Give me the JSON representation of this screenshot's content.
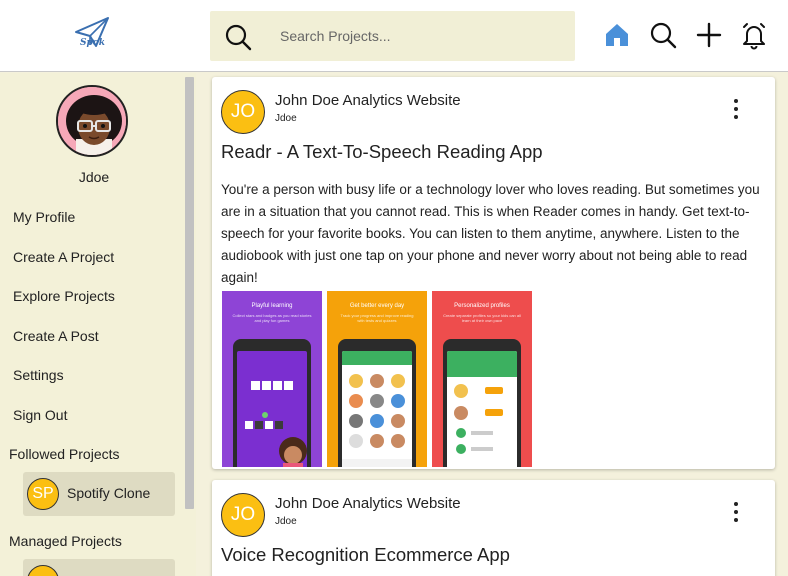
{
  "app": {
    "logo_text": "Spok"
  },
  "search": {
    "placeholder": "Search Projects..."
  },
  "header_icons": [
    "home-icon",
    "search-icon",
    "plus-icon",
    "bell-icon"
  ],
  "colors": {
    "accent": "#4a90d9",
    "badge": "#fbbf12",
    "background": "#f4f1dc",
    "chip": "#dedbc2"
  },
  "sidebar": {
    "username": "Jdoe",
    "nav": [
      {
        "label": "My Profile"
      },
      {
        "label": "Create A Project"
      },
      {
        "label": "Explore Projects"
      },
      {
        "label": "Create A Post"
      },
      {
        "label": "Settings"
      },
      {
        "label": "Sign Out"
      }
    ],
    "followed_label": "Followed Projects",
    "followed": [
      {
        "initials": "SP",
        "name": "Spotify Clone"
      }
    ],
    "managed_label": "Managed Projects"
  },
  "feed": {
    "posts": [
      {
        "initials": "JO",
        "owner": "John Doe Analytics Website",
        "handle": "Jdoe",
        "title": "Readr - A Text-To-Speech Reading App",
        "description": "You're a person with busy life or a technology lover who loves reading. But sometimes you are in a situation that you cannot read. This is when Reader comes in handy. Get text-to-speech for your favorite books. You can listen to them anytime, anywhere. Listen to the audiobook with just one tap on your phone and never worry about not being able to read again!",
        "screenshots": [
          {
            "caption": "Playful learning",
            "sub": "Collect stars and badges as you read stories and play fun games",
            "color": "#8e44d6"
          },
          {
            "caption": "Get better every day",
            "sub": "Track your progress and improve reading with tests and quizzes",
            "color": "#f5a20a"
          },
          {
            "caption": "Personalized profiles",
            "sub": "Create separate profiles so your kids can all learn at their own pace",
            "color": "#ee4d4d"
          }
        ]
      },
      {
        "initials": "JO",
        "owner": "John Doe Analytics Website",
        "handle": "Jdoe",
        "title": "Voice Recognition Ecommerce App"
      }
    ]
  }
}
